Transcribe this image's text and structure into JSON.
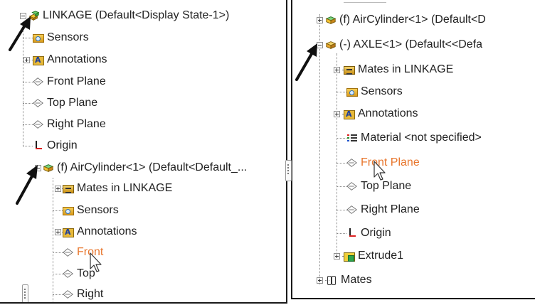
{
  "left_tree": {
    "root": "LINKAGE  (Default<Display State-1>)",
    "sensors": "Sensors",
    "annotations": "Annotations",
    "front_plane": "Front Plane",
    "top_plane": "Top Plane",
    "right_plane": "Right Plane",
    "origin": "Origin",
    "aircylinder": "(f) AirCylinder<1> (Default<Default_...",
    "mates_in": "Mates in LINKAGE",
    "sub_sensors": "Sensors",
    "sub_annotations": "Annotations",
    "sub_front": "Front",
    "sub_top": "Top",
    "sub_right": "Right"
  },
  "right_tree": {
    "aircylinder": "(f) AirCylinder<1> (Default<D",
    "axle": "(-) AXLE<1> (Default<<Defa",
    "mates_in": "Mates in LINKAGE",
    "sensors": "Sensors",
    "annotations": "Annotations",
    "material": "Material <not specified>",
    "front_plane": "Front Plane",
    "top_plane": "Top Plane",
    "right_plane": "Right Plane",
    "origin": "Origin",
    "extrude": "Extrude1",
    "mates": "Mates"
  },
  "colors": {
    "highlight_text": "#e8772e",
    "arrow": "#111111",
    "panel_border": "#1a1a1a"
  }
}
